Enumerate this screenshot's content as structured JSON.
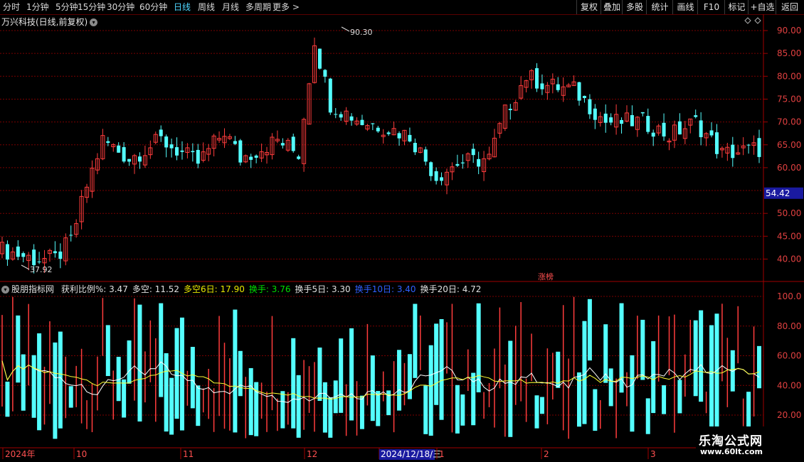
{
  "period_tabs": [
    "分时",
    "1分钟",
    "5分钟",
    "15分钟",
    "30分钟",
    "60分钟",
    "日线",
    "周线",
    "月线",
    "多周期",
    "更多 >"
  ],
  "active_tab": "日线",
  "right_buttons": [
    "复权",
    "叠加",
    "多股",
    "统计",
    "画线",
    "F10",
    "标记",
    "+自选",
    "返回"
  ],
  "stock_title": "万兴科技(日线,前复权)",
  "price_axis": [
    "90.30",
    "90.00",
    "85.00",
    "80.00",
    "75.00",
    "70.00",
    "65.00",
    "60.00",
    "54.42",
    "50.00",
    "45.00",
    "40.00",
    "37.92"
  ],
  "price_labels": {
    "high": "90.30",
    "low": "37.92",
    "current": "54.42",
    "tag": "涨榜"
  },
  "indicator": {
    "name": "股朋指标网",
    "items": [
      {
        "label": "获利比例%:",
        "value": "3.47",
        "color": "#e0e0e0"
      },
      {
        "label": "多空:",
        "value": "11.52",
        "color": "#e0e0e0"
      },
      {
        "label": "多空6日:",
        "value": "17.90",
        "color": "#e8e800"
      },
      {
        "label": "换手:",
        "value": "3.76",
        "color": "#00e000"
      },
      {
        "label": "换手5日:",
        "value": "3.30",
        "color": "#e0e0e0"
      },
      {
        "label": "换手10日:",
        "value": "3.40",
        "color": "#3060ff"
      },
      {
        "label": "换手20日:",
        "value": "4.72",
        "color": "#e0e0e0"
      }
    ]
  },
  "indicator_axis": [
    "100.0",
    "80.00",
    "60.00",
    "40.00",
    "20.00"
  ],
  "date_axis": [
    "2024年",
    "10",
    "11",
    "12",
    "2024/12/18/三",
    "1",
    "2",
    "3"
  ],
  "watermark": {
    "logo": "乐淘公式网",
    "url": "www.60lt.com"
  },
  "colors": {
    "up": "#ff3c3c",
    "down": "#54ffff",
    "grid": "#7a0000",
    "ma_white": "#ffffff",
    "ma_yellow": "#ffff33"
  }
}
